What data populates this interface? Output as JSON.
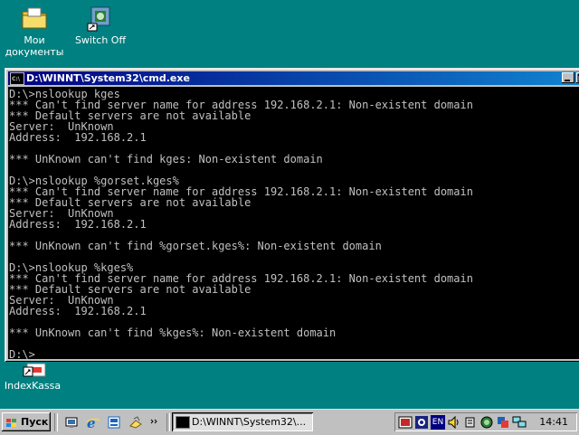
{
  "desktop": {
    "icons": [
      {
        "label_line1": "Мои",
        "label_line2": "документы",
        "icon": "folder-icon"
      },
      {
        "label_line1": "Switch Off",
        "label_line2": "",
        "icon": "switch-off-icon"
      },
      {
        "label_line1": "IndexKassa",
        "label_line2": "",
        "icon": "shortcut-icon"
      }
    ]
  },
  "window": {
    "title": "D:\\WINNT\\System32\\cmd.exe",
    "console_lines": [
      "D:\\>nslookup kges",
      "*** Can't find server name for address 192.168.2.1: Non-existent domain",
      "*** Default servers are not available",
      "Server:  UnKnown",
      "Address:  192.168.2.1",
      "",
      "*** UnKnown can't find kges: Non-existent domain",
      "",
      "D:\\>nslookup %gorset.kges%",
      "*** Can't find server name for address 192.168.2.1: Non-existent domain",
      "*** Default servers are not available",
      "Server:  UnKnown",
      "Address:  192.168.2.1",
      "",
      "*** UnKnown can't find %gorset.kges%: Non-existent domain",
      "",
      "D:\\>nslookup %kges%",
      "*** Can't find server name for address 192.168.2.1: Non-existent domain",
      "*** Default servers are not available",
      "Server:  UnKnown",
      "Address:  192.168.2.1",
      "",
      "*** UnKnown can't find %kges%: Non-existent domain",
      "",
      "D:\\>"
    ]
  },
  "taskbar": {
    "start_label": "Пуск",
    "task_label": "D:\\WINNT\\System32\\...",
    "tray_lang": "EN",
    "clock": "14:41"
  },
  "colors": {
    "desktop": "#008080",
    "title_active": "#000080",
    "console_bg": "#000000",
    "console_fg": "#c0c0c0"
  }
}
